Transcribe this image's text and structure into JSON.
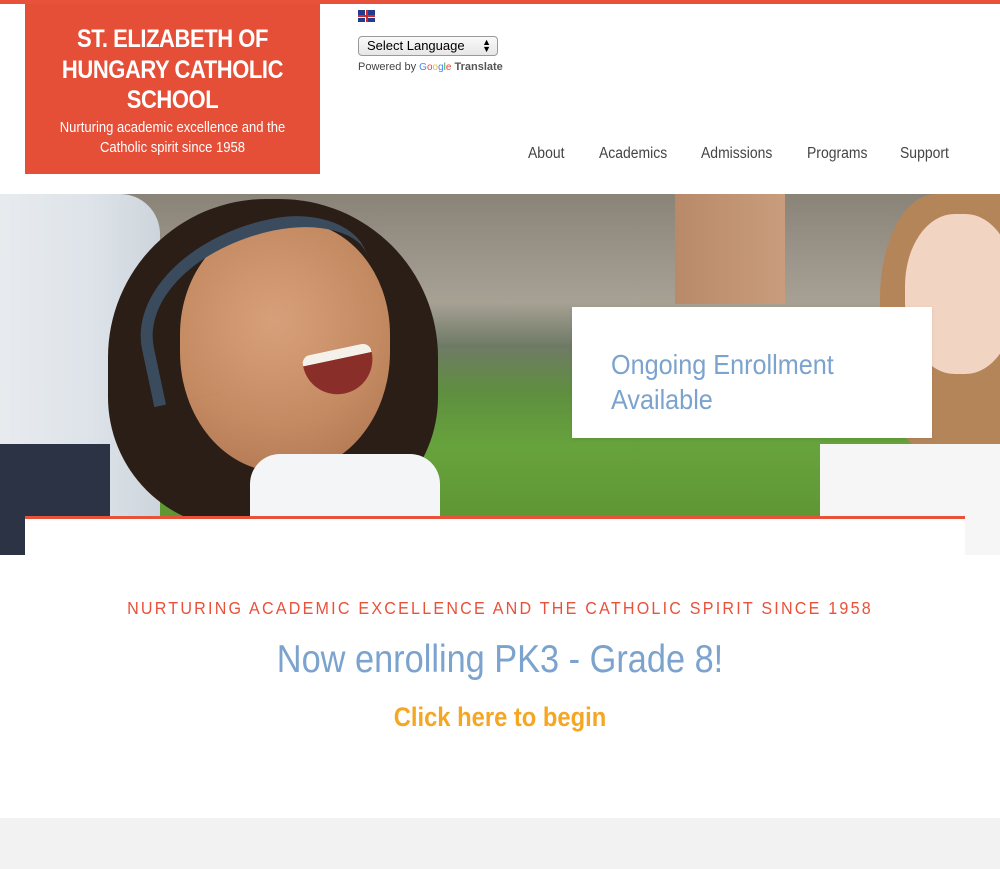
{
  "brand": {
    "title": "ST. ELIZABETH OF HUNGARY CATHOLIC SCHOOL",
    "tagline": "Nurturing academic excellence and the Catholic spirit since 1958",
    "color": "#e54e37"
  },
  "translate": {
    "flag_icon": "uk-flag-icon",
    "select_label": "Select Language",
    "powered_by": "Powered by",
    "google": "Google",
    "translate_word": "Translate"
  },
  "nav": {
    "items": [
      "About",
      "Academics",
      "Admissions",
      "Programs",
      "Support"
    ]
  },
  "hero": {
    "promo": "Ongoing Enrollment\nAvailable"
  },
  "main": {
    "tagline": "NURTURING ACADEMIC EXCELLENCE AND THE CATHOLIC SPIRIT SINCE 1958",
    "headline": "Now enrolling PK3 - Grade 8!",
    "cta": "Click here to begin"
  },
  "colors": {
    "accent": "#e8513a",
    "blue_text": "#7ba3cd",
    "cta": "#f5a623"
  }
}
